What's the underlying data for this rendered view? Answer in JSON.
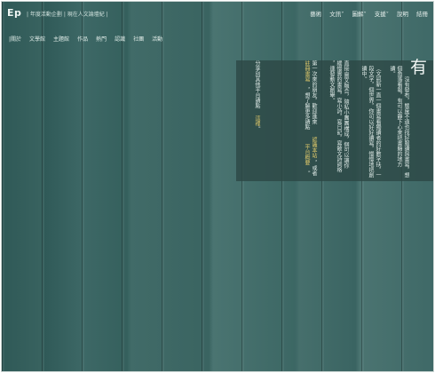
{
  "header": {
    "logo": "Ep",
    "slogan": "| 年度活動企劃 | 現在人文論壇紀 |",
    "nav": [
      "藝術",
      "文訊˅",
      "圖解˅",
      "支援˅",
      "說明",
      "結冊"
    ]
  },
  "subnav": [
    "|關於",
    "文學館",
    "主題館",
    "作品",
    "熱門",
    "認識",
    "社團",
    "活動"
  ],
  "article": {
    "bigchar": "有",
    "columns": [
      {
        "text": "沒有發布，態度不過也找好服讀與書寫，想",
        "accent": false
      },
      {
        "text": "個角落看報，有可以靜下心來把書籍的地方",
        "accent": false
      },
      {
        "text": "讀。",
        "accent": false
      },
      {
        "text": "（文訊新一直一個書寫看獨讀者的好數字扶，一",
        "accent": false
      },
      {
        "text": "段文字，個世界，你可以好好讀寫，慢慢地把創",
        "accent": false
      },
      {
        "text": "讀中。",
        "accent": false
      },
      {
        "text": "直接·圖文融合，隨私小團團構成，個可以讓你",
        "accent": false
      },
      {
        "text": "緩慢實的書寫，寫小詩，寫日記，寫散文詩詞格",
        "accent": false
      },
      {
        "text": "，連發動文創舉。",
        "accent": false
      },
      {
        "text": "第一次來的朋友，歡迎進來",
        "accent": false
      },
      {
        "text": "認識本站",
        "accent": true
      },
      {
        "text": "，或者",
        "accent": false
      },
      {
        "text": "註冊書寫",
        "accent": true
      },
      {
        "text": "，想了解更多請點",
        "accent": false
      },
      {
        "text": "平台概要",
        "accent": true
      },
      {
        "text": "。",
        "accent": false
      },
      {
        "text": "分享別其他平台請點",
        "accent": false
      },
      {
        "text": "這裡",
        "accent": true
      },
      {
        "text": "。",
        "accent": false
      }
    ]
  }
}
